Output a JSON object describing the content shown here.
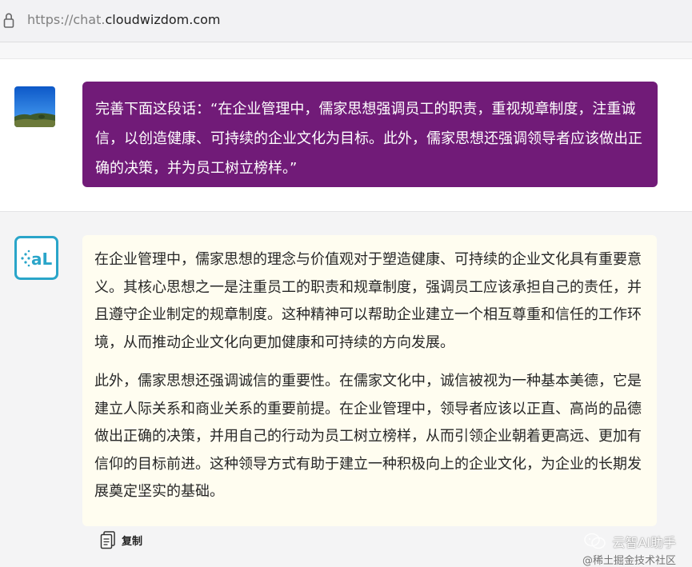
{
  "browser": {
    "url_prefix": "https://chat.",
    "url_domain": "cloudwizdom.com"
  },
  "user_message": {
    "text": "完善下面这段话：“在企业管理中，儒家思想强调员工的职责，重视规章制度，注重诚信，以创造健康、可持续的企业文化为目标。此外，儒家思想还强调领导者应该做出正确的决策，并为员工树立榜样。”"
  },
  "ai_message": {
    "paragraphs": [
      "在企业管理中，儒家思想的理念与价值观对于塑造健康、可持续的企业文化具有重要意义。其核心思想之一是注重员工的职责和规章制度，强调员工应该承担自己的责任，并且遵守企业制定的规章制度。这种精神可以帮助企业建立一个相互尊重和信任的工作环境，从而推动企业文化向更加健康和可持续的方向发展。",
      "此外，儒家思想还强调诚信的重要性。在儒家文化中，诚信被视为一种基本美德，它是建立人际关系和商业关系的重要前提。在企业管理中，领导者应该以正直、高尚的品德做出正确的决策，并用自己的行动为员工树立榜样，从而引领企业朝着更高远、更加有信仰的目标前进。这种领导方式有助于建立一种积极向上的企业文化，为企业的长期发展奠定坚实的基础。"
    ],
    "copy_label": "复制"
  },
  "watermark": {
    "title": "云智AI助手",
    "subtitle": "@稀土掘金技术社区"
  },
  "icons": {
    "lock": "lock-icon",
    "copy": "copy-icon",
    "wechat": "wechat-icon"
  },
  "colors": {
    "user_bubble": "#711b78",
    "ai_bubble": "#fffdf0",
    "ai_logo": "#2aa5c9"
  }
}
